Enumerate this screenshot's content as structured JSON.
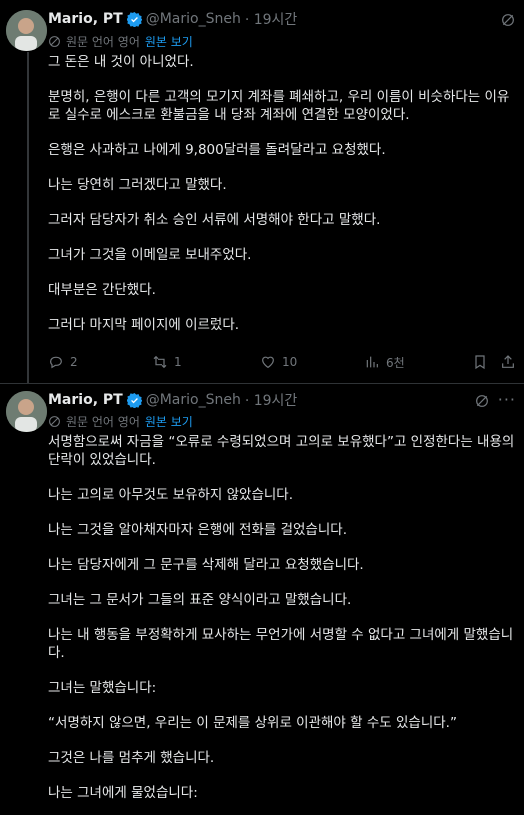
{
  "tweets": [
    {
      "name": "Mario, PT",
      "handle": "@Mario_Sneh",
      "time": "· 19시간",
      "translate_label": "원문 언어 영어",
      "view_original": "원본 보기",
      "paragraphs": [
        "그 돈은 내 것이 아니었다.",
        "분명히, 은행이 다른 고객의 모기지 계좌를 폐쇄하고, 우리 이름이 비슷하다는 이유로 실수로 에스크로 환불금을 내 당좌 계좌에 연결한 모양이었다.",
        "은행은 사과하고 나에게 9,800달러를 돌려달라고 요청했다.",
        "나는 당연히 그러겠다고 말했다.",
        "그러자 담당자가 취소 승인 서류에 서명해야 한다고 말했다.",
        "그녀가 그것을 이메일로 보내주었다.",
        "대부분은 간단했다.",
        "그러다 마지막 페이지에 이르렀다."
      ],
      "actions": {
        "replies": "2",
        "reposts": "1",
        "likes": "10",
        "views": "6천"
      }
    },
    {
      "name": "Mario, PT",
      "handle": "@Mario_Sneh",
      "time": "· 19시간",
      "translate_label": "원문 언어 영어",
      "view_original": "원본 보기",
      "paragraphs": [
        "서명함으로써 자금을 “오류로 수령되었으며 고의로 보유했다”고 인정한다는 내용의 단락이 있었습니다.",
        "나는 고의로 아무것도 보유하지 않았습니다.",
        "나는 그것을 알아채자마자 은행에 전화를 걸었습니다.",
        "나는 담당자에게 그 문구를 삭제해 달라고 요청했습니다.",
        "그녀는 그 문서가 그들의 표준 양식이라고 말했습니다.",
        "나는 내 행동을 부정확하게 묘사하는 무언가에 서명할 수 없다고 그녀에게 말했습니다.",
        "그녀는 말했습니다:",
        "“서명하지 않으면, 우리는 이 문제를 상위로 이관해야 할 수도 있습니다.”",
        "그것은 나를 멈추게 했습니다.",
        "나는 그녀에게 물었습니다:"
      ]
    }
  ],
  "colors": {
    "background": "#000000",
    "text": "#e7e9ea",
    "muted": "#71767b",
    "accent": "#1d9bf0",
    "divider": "#2f3336"
  },
  "icons": [
    "grok-icon",
    "verified-badge-icon",
    "translate-icon",
    "reply-icon",
    "repost-icon",
    "like-icon",
    "views-icon",
    "bookmark-icon",
    "share-icon",
    "more-icon"
  ]
}
